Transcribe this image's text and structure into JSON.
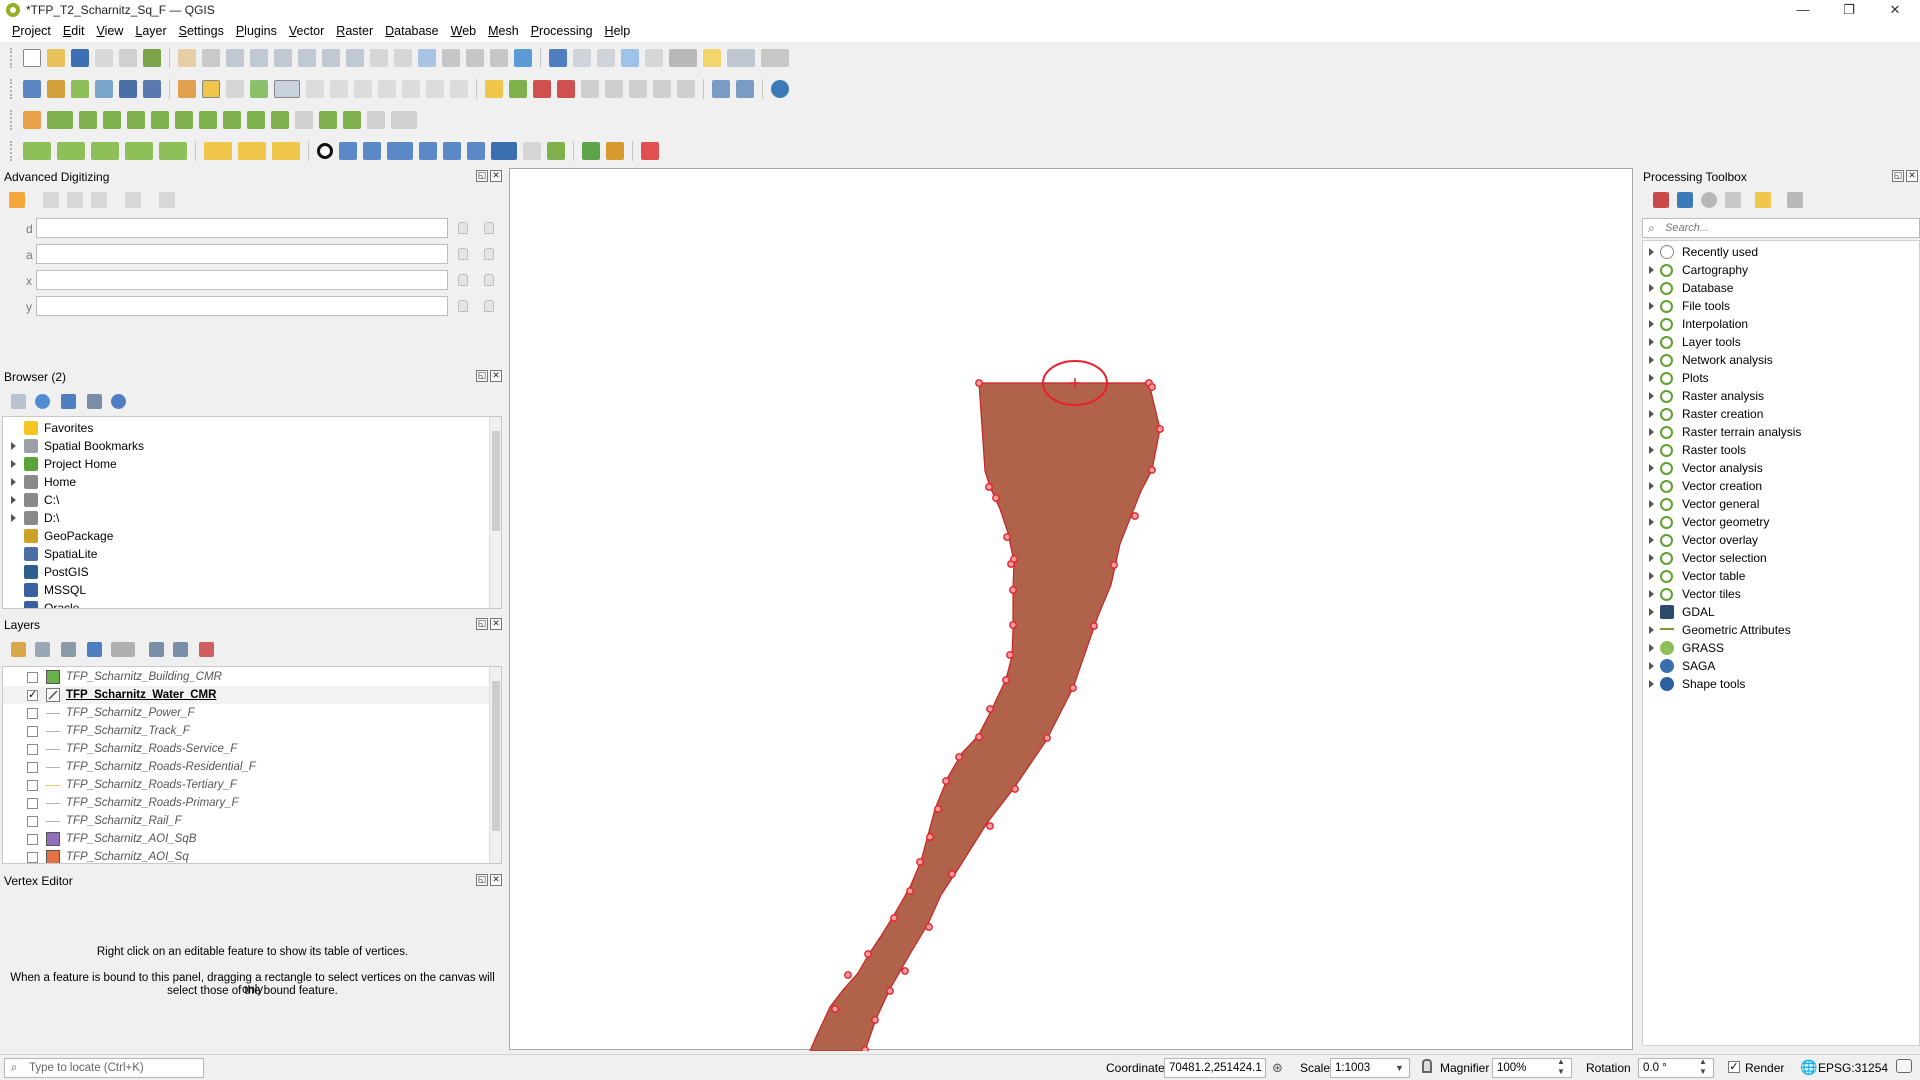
{
  "window": {
    "title": "*TFP_T2_Scharnitz_Sq_F — QGIS",
    "minimize": "—",
    "maximize": "❐",
    "close": "✕"
  },
  "menu": [
    "Project",
    "Edit",
    "View",
    "Layer",
    "Settings",
    "Plugins",
    "Vector",
    "Raster",
    "Database",
    "Web",
    "Mesh",
    "Processing",
    "Help"
  ],
  "adv_digitizing": {
    "title": "Advanced Digitizing",
    "labels": [
      "d",
      "a",
      "x",
      "y"
    ]
  },
  "browser": {
    "title": "Browser (2)",
    "items": [
      {
        "label": "Favorites",
        "arrow": false,
        "icon": "star-icon",
        "color": "#f3c623"
      },
      {
        "label": "Spatial Bookmarks",
        "arrow": true,
        "icon": "bookmark-icon",
        "color": "#9aa0a6"
      },
      {
        "label": "Project Home",
        "arrow": true,
        "icon": "project-home-icon",
        "color": "#59a33a"
      },
      {
        "label": "Home",
        "arrow": true,
        "icon": "home-folder-icon",
        "color": "#8a8a8a"
      },
      {
        "label": "C:\\",
        "arrow": true,
        "icon": "drive-icon",
        "color": "#8a8a8a"
      },
      {
        "label": "D:\\",
        "arrow": true,
        "icon": "drive-icon",
        "color": "#8a8a8a"
      },
      {
        "label": "GeoPackage",
        "arrow": false,
        "icon": "geopackage-icon",
        "color": "#c9a227"
      },
      {
        "label": "SpatiaLite",
        "arrow": false,
        "icon": "spatialite-icon",
        "color": "#4a6fa5"
      },
      {
        "label": "PostGIS",
        "arrow": false,
        "icon": "postgis-icon",
        "color": "#2f5f8f"
      },
      {
        "label": "MSSQL",
        "arrow": false,
        "icon": "mssql-icon",
        "color": "#3a5fa0"
      },
      {
        "label": "Oracle",
        "arrow": false,
        "icon": "oracle-icon",
        "color": "#3a5fa0"
      }
    ]
  },
  "layers": {
    "title": "Layers",
    "items": [
      {
        "label": "TFP_Scharnitz_Building_CMR",
        "checked": false,
        "active": false,
        "sym": "fill",
        "color": "#6ab04c"
      },
      {
        "label": "TFP_Scharnitz_Water_CMR",
        "checked": true,
        "active": true,
        "sym": "edit",
        "color": "#8a8a8a"
      },
      {
        "label": "TFP_Scharnitz_Power_F",
        "checked": false,
        "active": false,
        "sym": "line",
        "color": "#b0b0b0"
      },
      {
        "label": "TFP_Scharnitz_Track_F",
        "checked": false,
        "active": false,
        "sym": "line",
        "color": "#b0b0b0"
      },
      {
        "label": "TFP_Scharnitz_Roads-Service_F",
        "checked": false,
        "active": false,
        "sym": "line",
        "color": "#b0b0b0"
      },
      {
        "label": "TFP_Scharnitz_Roads-Residential_F",
        "checked": false,
        "active": false,
        "sym": "line",
        "color": "#b0b0b0"
      },
      {
        "label": "TFP_Scharnitz_Roads-Tertiary_F",
        "checked": false,
        "active": false,
        "sym": "line",
        "color": "#e6c47a"
      },
      {
        "label": "TFP_Scharnitz_Roads-Primary_F",
        "checked": false,
        "active": false,
        "sym": "line",
        "color": "#b0b0b0"
      },
      {
        "label": "TFP_Scharnitz_Rail_F",
        "checked": false,
        "active": false,
        "sym": "line",
        "color": "#b0b0b0"
      },
      {
        "label": "TFP_Scharnitz_AOI_SqB",
        "checked": false,
        "active": false,
        "sym": "fill",
        "color": "#8e6fb8"
      },
      {
        "label": "TFP_Scharnitz_AOI_Sq",
        "checked": false,
        "active": false,
        "sym": "fill",
        "color": "#e5734a"
      }
    ]
  },
  "vertex_editor": {
    "title": "Vertex Editor",
    "line1": "Right click on an editable feature to show its table of vertices.",
    "line2": "When a feature is bound to this panel, dragging a rectangle to select vertices on the canvas will only",
    "line3": "select those of the bound feature."
  },
  "processing": {
    "title": "Processing Toolbox",
    "search_placeholder": "Search...",
    "items": [
      {
        "label": "Recently used",
        "icon": "clock-icon"
      },
      {
        "label": "Cartography",
        "icon": "qgis-icon"
      },
      {
        "label": "Database",
        "icon": "qgis-icon"
      },
      {
        "label": "File tools",
        "icon": "qgis-icon"
      },
      {
        "label": "Interpolation",
        "icon": "qgis-icon"
      },
      {
        "label": "Layer tools",
        "icon": "qgis-icon"
      },
      {
        "label": "Network analysis",
        "icon": "qgis-icon"
      },
      {
        "label": "Plots",
        "icon": "qgis-icon"
      },
      {
        "label": "Raster analysis",
        "icon": "qgis-icon"
      },
      {
        "label": "Raster creation",
        "icon": "qgis-icon"
      },
      {
        "label": "Raster terrain analysis",
        "icon": "qgis-icon"
      },
      {
        "label": "Raster tools",
        "icon": "qgis-icon"
      },
      {
        "label": "Vector analysis",
        "icon": "qgis-icon"
      },
      {
        "label": "Vector creation",
        "icon": "qgis-icon"
      },
      {
        "label": "Vector general",
        "icon": "qgis-icon"
      },
      {
        "label": "Vector geometry",
        "icon": "qgis-icon"
      },
      {
        "label": "Vector overlay",
        "icon": "qgis-icon"
      },
      {
        "label": "Vector selection",
        "icon": "qgis-icon"
      },
      {
        "label": "Vector table",
        "icon": "qgis-icon"
      },
      {
        "label": "Vector tiles",
        "icon": "qgis-icon"
      },
      {
        "label": "GDAL",
        "icon": "gdal-icon"
      },
      {
        "label": "Geometric Attributes",
        "icon": "geometric-attributes-icon"
      },
      {
        "label": "GRASS",
        "icon": "grass-icon"
      },
      {
        "label": "SAGA",
        "icon": "saga-icon"
      },
      {
        "label": "Shape tools",
        "icon": "shape-tools-icon"
      }
    ]
  },
  "status": {
    "locate_placeholder": "Type to locate (Ctrl+K)",
    "coordinate_label": "Coordinate",
    "coordinate_value": "70481.2,251424.1",
    "scale_label": "Scale",
    "scale_value": "1:1003",
    "magnifier_label": "Magnifier",
    "magnifier_value": "100%",
    "rotation_label": "Rotation",
    "rotation_value": "0.0 °",
    "render_label": "Render",
    "crs": "EPSG:31254"
  },
  "colors": {
    "polygon_fill": "#b0624a",
    "polygon_stroke": "#cc2222",
    "vertex": "#e8202a"
  }
}
